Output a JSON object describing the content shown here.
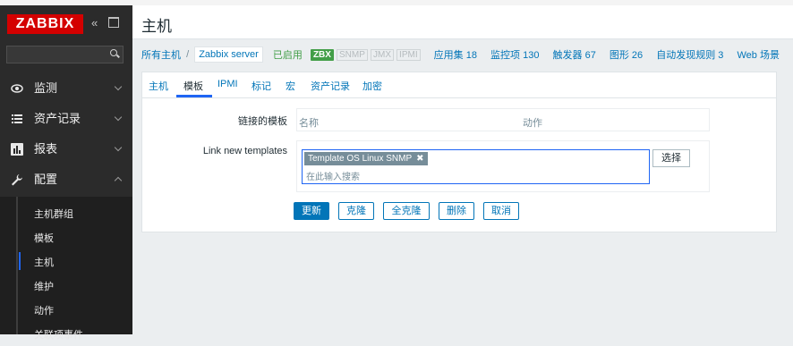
{
  "sidebar": {
    "logo": "ZABBIX",
    "collapse_icon": "«",
    "menu": [
      {
        "label": "监测",
        "icon": "eye-icon"
      },
      {
        "label": "资产记录",
        "icon": "list-icon"
      },
      {
        "label": "报表",
        "icon": "bar-chart-icon"
      },
      {
        "label": "配置",
        "icon": "wrench-icon"
      }
    ],
    "submenu": [
      "主机群组",
      "模板",
      "主机",
      "维护",
      "动作",
      "关联项事件"
    ],
    "active_submenu": "主机"
  },
  "header": {
    "title": "主机"
  },
  "breadcrumb": {
    "all_hosts": "所有主机",
    "separator": "/",
    "host": "Zabbix server",
    "status": "已启用",
    "zbx": "ZBX",
    "snmp": "SNMP",
    "jmx": "JMX",
    "ipmi": "IPMI",
    "applications": "应用集 18",
    "items": "监控项 130",
    "triggers": "触发器 67",
    "graphs": "图形 26",
    "discovery": "自动发现规则 3",
    "web": "Web 场景"
  },
  "tabs": [
    "主机",
    "模板",
    "IPMI",
    "标记",
    "宏",
    "资产记录",
    "加密"
  ],
  "active_tab": "模板",
  "form": {
    "linked_label": "链接的模板",
    "col_name": "名称",
    "col_action": "动作",
    "link_new_label": "Link new templates",
    "chip": "Template OS Linux SNMP",
    "placeholder": "在此输入搜索",
    "select_button": "选择"
  },
  "buttons": {
    "update": "更新",
    "clone": "克隆",
    "full_clone": "全克隆",
    "delete": "删除",
    "cancel": "取消"
  },
  "colors": {
    "brand": "#d40000",
    "accent": "#0275b8",
    "sidebar_bg": "#2b2b2b",
    "enabled": "#429e47"
  }
}
